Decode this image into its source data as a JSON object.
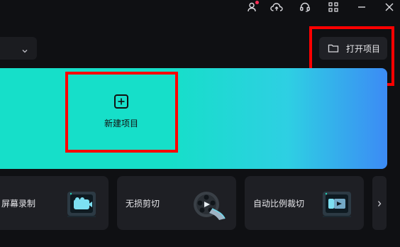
{
  "titlebar": {
    "icons": [
      "user-icon",
      "cloud-upload-icon",
      "headset-icon",
      "grid-icon",
      "minimize-icon",
      "close-icon"
    ],
    "notification_dot_color": "#ff2d55"
  },
  "actions": {
    "open_project_label": "打开项目",
    "new_project_label": "新建项目"
  },
  "colors": {
    "background": "#0f1013",
    "hero_gradient": [
      "#16dfc9",
      "#2ecfe3",
      "#3c8bf5"
    ],
    "highlight": "#ff0000"
  },
  "tools": [
    {
      "label": "屏幕录制",
      "icon": "screen-record-icon"
    },
    {
      "label": "无损剪切",
      "icon": "film-reel-icon"
    },
    {
      "label": "自动比例裁切",
      "icon": "auto-crop-icon"
    }
  ]
}
